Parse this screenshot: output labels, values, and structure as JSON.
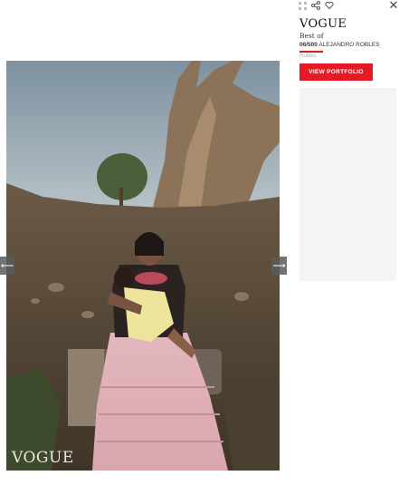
{
  "toolbar": {
    "grid_icon": "grid-icon",
    "share_icon": "share-icon",
    "heart_icon": "heart-icon",
    "close_icon": "close-icon",
    "close_glyph": "✕"
  },
  "panel": {
    "brand": "VOGUE",
    "best_of": "Best of",
    "counter": "06/500",
    "photographer": "ALEJANDRO ROBLES",
    "subject": "Robles",
    "button_label": "VIEW PORTFOLIO"
  },
  "photo": {
    "watermark": "VOGUE",
    "prev_glyph": "⟵",
    "next_glyph": "⟶"
  },
  "colors": {
    "accent": "#e51a24",
    "background": "#ffffff",
    "ad_panel": "#f4f4f4"
  }
}
